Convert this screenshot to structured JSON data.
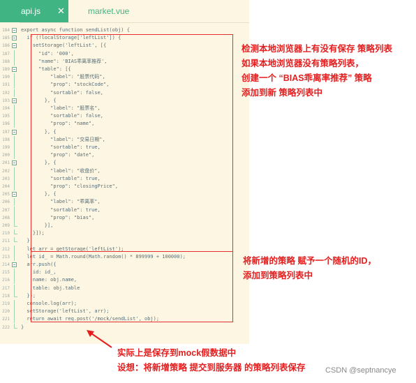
{
  "tabs": [
    {
      "label": "api.js",
      "close": "✕"
    },
    {
      "label": "market.vue"
    }
  ],
  "code_lines": [
    {
      "n": "184",
      "fold": "open",
      "t": "export async function sendList(obj) {"
    },
    {
      "n": "185",
      "fold": "open",
      "t": "  if (!localStorage['leftList']) {"
    },
    {
      "n": "186",
      "fold": "open",
      "t": "    setStorage('leftList', [{"
    },
    {
      "n": "187",
      "fold": "",
      "t": "      \"id\": '000',"
    },
    {
      "n": "188",
      "fold": "",
      "t": "      \"name\": 'BIAS乖离率推荐',"
    },
    {
      "n": "189",
      "fold": "open",
      "t": "      \"table\": [{"
    },
    {
      "n": "190",
      "fold": "",
      "t": "          \"label\": \"股票代码\","
    },
    {
      "n": "191",
      "fold": "",
      "t": "          \"prop\": \"stockCode\","
    },
    {
      "n": "192",
      "fold": "",
      "t": "          \"sortable\": false,"
    },
    {
      "n": "193",
      "fold": "open",
      "t": "        }, {"
    },
    {
      "n": "194",
      "fold": "",
      "t": "          \"label\": \"股票名\","
    },
    {
      "n": "195",
      "fold": "",
      "t": "          \"sortable\": false,"
    },
    {
      "n": "196",
      "fold": "",
      "t": "          \"prop\": \"name\","
    },
    {
      "n": "197",
      "fold": "open",
      "t": "        }, {"
    },
    {
      "n": "198",
      "fold": "",
      "t": "          \"label\": \"交易日期\","
    },
    {
      "n": "199",
      "fold": "",
      "t": "          \"sortable\": true,"
    },
    {
      "n": "200",
      "fold": "",
      "t": "          \"prop\": \"date\","
    },
    {
      "n": "201",
      "fold": "open",
      "t": "        }, {"
    },
    {
      "n": "202",
      "fold": "",
      "t": "          \"label\": \"收盘价\","
    },
    {
      "n": "203",
      "fold": "",
      "t": "          \"sortable\": true,"
    },
    {
      "n": "204",
      "fold": "",
      "t": "          \"prop\": \"closingPrice\","
    },
    {
      "n": "205",
      "fold": "open",
      "t": "        }, {"
    },
    {
      "n": "206",
      "fold": "",
      "t": "          \"label\": \"乖离率\","
    },
    {
      "n": "207",
      "fold": "",
      "t": "          \"sortable\": true,"
    },
    {
      "n": "208",
      "fold": "",
      "t": "          \"prop\": \"bias\","
    },
    {
      "n": "209",
      "fold": "end",
      "t": "        }],"
    },
    {
      "n": "210",
      "fold": "end",
      "t": "    }]);"
    },
    {
      "n": "211",
      "fold": "end",
      "t": "  }"
    },
    {
      "n": "212",
      "fold": "",
      "t": "  let arr = getStorage('leftList');"
    },
    {
      "n": "213",
      "fold": "",
      "t": "  let id_ = Math.round(Math.random() * 899999 + 100000);"
    },
    {
      "n": "214",
      "fold": "open",
      "t": "  arr.push({"
    },
    {
      "n": "215",
      "fold": "",
      "t": "    id: id_,"
    },
    {
      "n": "216",
      "fold": "",
      "t": "    name: obj.name,"
    },
    {
      "n": "217",
      "fold": "",
      "t": "    table: obj.table"
    },
    {
      "n": "218",
      "fold": "end",
      "t": "  });"
    },
    {
      "n": "219",
      "fold": "",
      "t": "  console.log(arr);"
    },
    {
      "n": "220",
      "fold": "",
      "t": "  setStorage('leftList', arr);"
    },
    {
      "n": "221",
      "fold": "",
      "t": "  return await req.post('/mock/sendList', obj);"
    },
    {
      "n": "222",
      "fold": "end",
      "t": "}"
    }
  ],
  "annotations": {
    "note1": [
      "检测本地浏览器上有没有保存  策略列表",
      "如果本地浏览器没有策略列表，",
      "创建一个   “BIAS乖离率推荐”   策略",
      "添加到新 策略列表中"
    ],
    "note2": [
      "将新增的策略 赋予一个随机的ID，",
      "添加到策略列表中"
    ],
    "note3": [
      "实际上是保存到mock假数据中",
      "设想：将新增策略  提交到服务器 的策略列表保存"
    ]
  },
  "watermark": "CSDN @septnancye",
  "colors": {
    "editor_bg": "#fdf6e3",
    "tab_active": "#40b583",
    "annotation_red": "#e41e1e"
  }
}
